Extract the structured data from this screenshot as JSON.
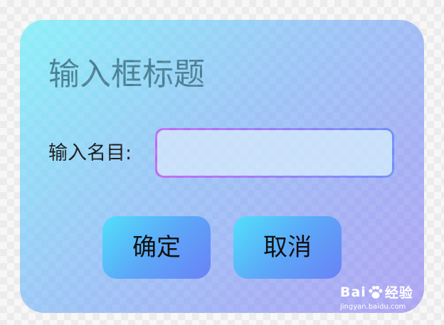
{
  "dialog": {
    "title": "输入框标题",
    "label": "输入名目:",
    "input": {
      "value": "",
      "placeholder": ""
    },
    "buttons": {
      "confirm": "确定",
      "cancel": "取消"
    }
  },
  "watermark": {
    "brand_left": "Bai",
    "brand_right": "经验",
    "url": "jingyan.baidu.com",
    "icon": "paw-icon"
  },
  "colors": {
    "title": "#4a7f93",
    "button_gradient_start": "#52e0fa",
    "button_gradient_end": "#6a82f6",
    "input_border_start": "#c26af2",
    "input_border_end": "#6f8ef8"
  }
}
